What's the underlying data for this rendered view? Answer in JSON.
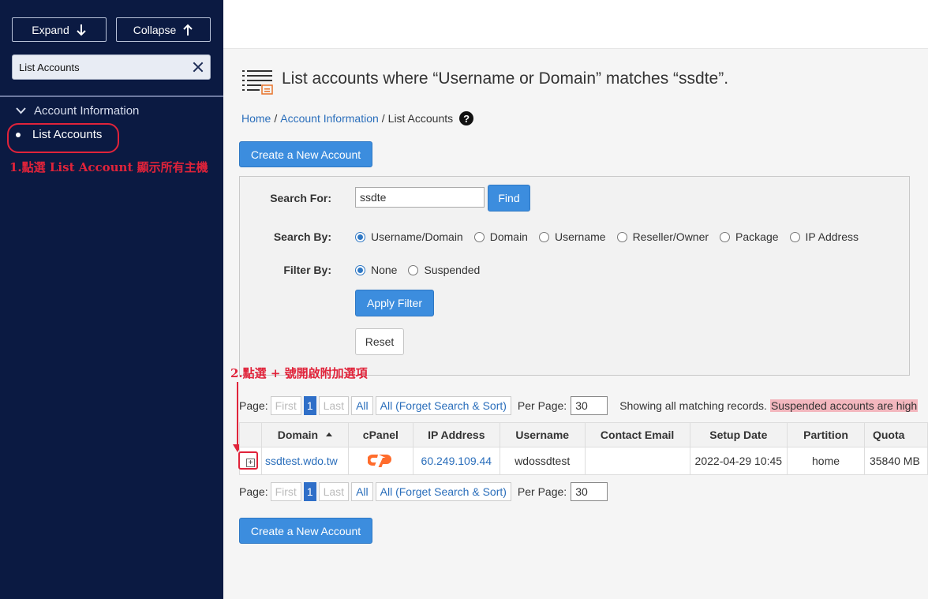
{
  "sidebar": {
    "expand_label": "Expand",
    "collapse_label": "Collapse",
    "search_value": "List Accounts",
    "section_label": "Account Information",
    "item_label": "List Accounts"
  },
  "annotations": {
    "step1": "1.點選 List Account 顯示所有主機",
    "step2": "2.點選 + 號開啟附加選項"
  },
  "header": {
    "title": "List accounts where “Username or Domain” matches “ssdte”.",
    "breadcrumb": [
      "Home",
      "Account Information",
      "List Accounts"
    ],
    "help_icon": "?"
  },
  "actions": {
    "create_label": "Create a New Account"
  },
  "filter": {
    "search_for_label": "Search For:",
    "search_value": "ssdte",
    "find_label": "Find",
    "search_by_label": "Search By:",
    "search_by_options": [
      "Username/Domain",
      "Domain",
      "Username",
      "Reseller/Owner",
      "Package",
      "IP Address"
    ],
    "search_by_selected": "Username/Domain",
    "filter_by_label": "Filter By:",
    "filter_by_options": [
      "None",
      "Suspended"
    ],
    "filter_by_selected": "None",
    "apply_label": "Apply Filter",
    "reset_label": "Reset"
  },
  "pager": {
    "page_label": "Page:",
    "first": "First",
    "current": "1",
    "last": "Last",
    "all": "All",
    "all_forget": "All (Forget Search & Sort)",
    "per_page_label": "Per Page:",
    "per_page_value": "30",
    "showing_text": "Showing all matching records.",
    "suspended_note": "Suspended accounts are high"
  },
  "table": {
    "columns": [
      "Domain",
      "cPanel",
      "IP Address",
      "Username",
      "Contact Email",
      "Setup Date",
      "Partition",
      "Quota"
    ],
    "rows": [
      {
        "domain": "ssdtest.wdo.tw",
        "ip": "60.249.109.44",
        "username": "wdossdtest",
        "contact_email": "",
        "setup_date": "2022-04-29 10:45",
        "partition": "home",
        "quota": "35840 MB"
      }
    ]
  },
  "colors": {
    "sidebar_bg": "#0b1a42",
    "primary": "#3c8dde",
    "link": "#2a6ebb",
    "annotation": "#e0233a",
    "cpanel_orange": "#ff6c2c"
  }
}
